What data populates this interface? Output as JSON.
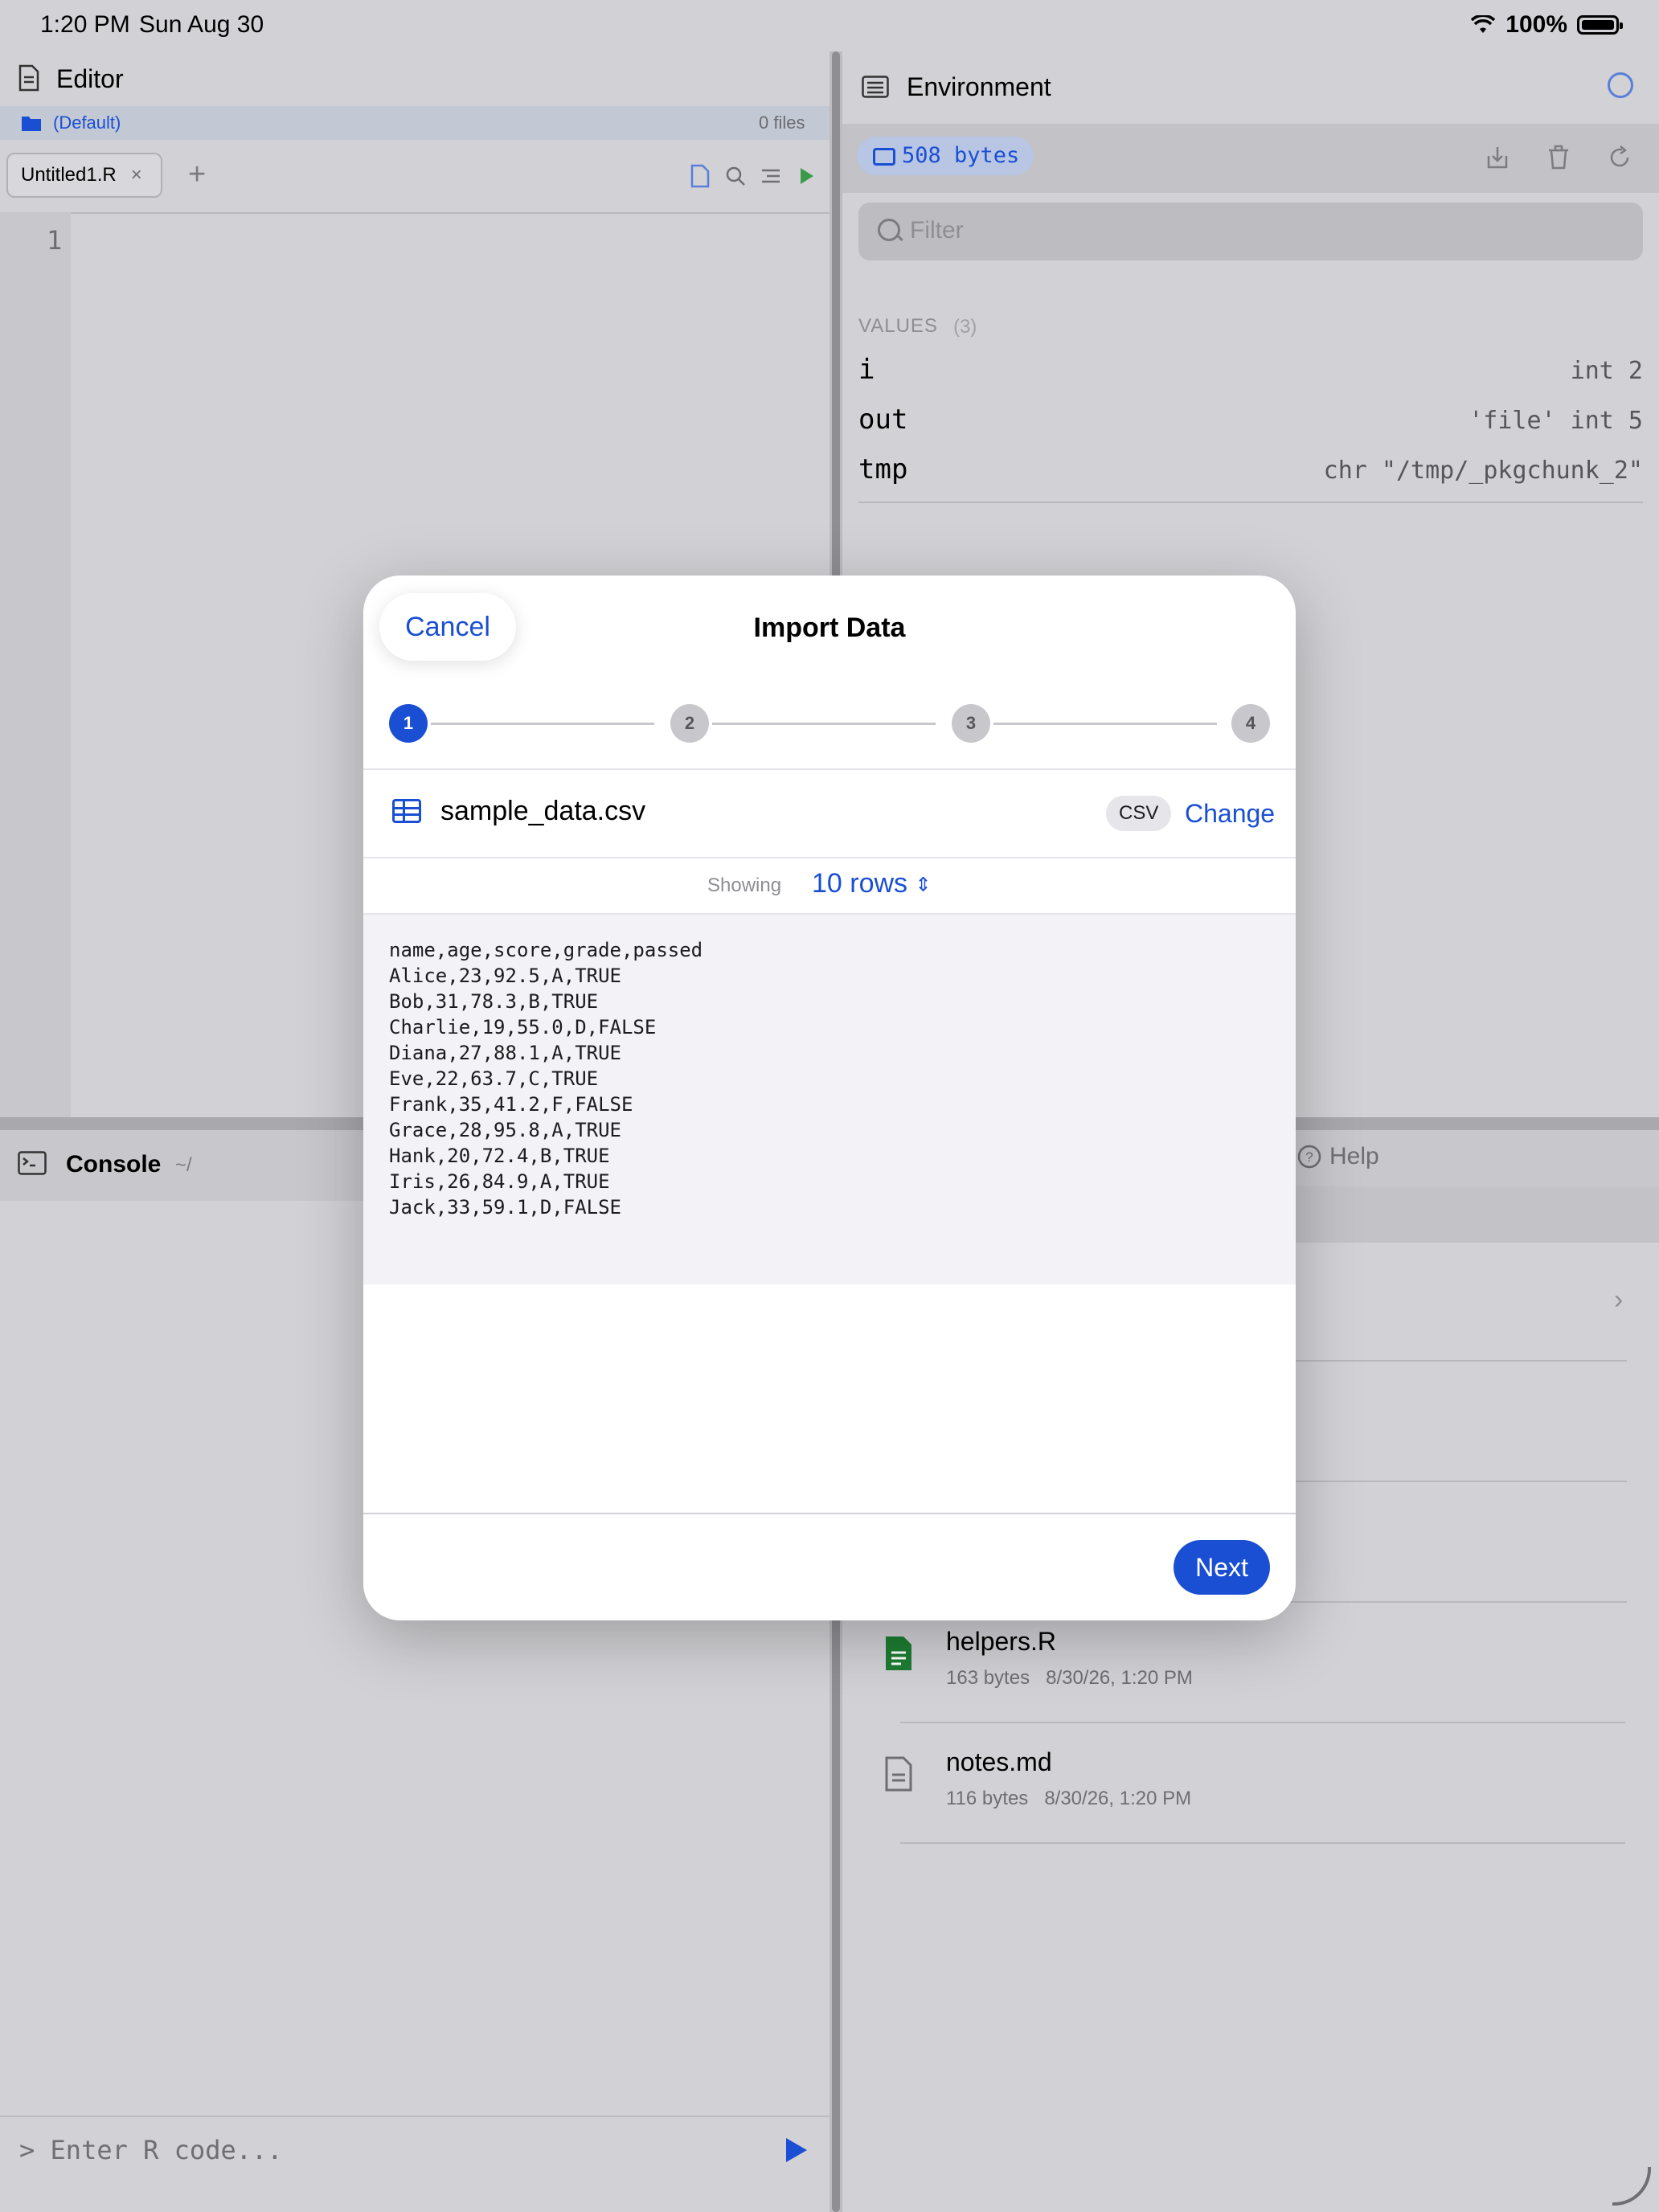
{
  "status_bar": {
    "time": "1:20 PM",
    "date": "Sun Aug 30",
    "battery": "100%"
  },
  "editor": {
    "title": "Editor",
    "project": "(Default)",
    "file_count": "0 files",
    "tab_label": "Untitled1.R",
    "tab_close": "×",
    "add_tab": "+",
    "line_number": "1"
  },
  "console": {
    "title": "Console",
    "path": "~/",
    "placeholder": "> Enter R code..."
  },
  "environment": {
    "title": "Environment",
    "memory": "508 bytes",
    "filter_placeholder": "Filter",
    "section_label": "VALUES",
    "section_count": "(3)",
    "variables": [
      {
        "name": "i",
        "value": "int 2"
      },
      {
        "name": "out",
        "value": "'file' int 5"
      },
      {
        "name": "tmp",
        "value": "chr \"/tmp/_pkgchunk_2\""
      }
    ]
  },
  "files_panel": {
    "help_tab": "Help",
    "files": [
      {
        "name": "helpers.R",
        "size": "163 bytes",
        "date": "8/30/26, 1:20 PM",
        "icon": "r-file-icon"
      },
      {
        "name": "notes.md",
        "size": "116 bytes",
        "date": "8/30/26, 1:20 PM",
        "icon": "document-icon"
      }
    ]
  },
  "modal": {
    "cancel": "Cancel",
    "title": "Import Data",
    "steps": [
      "1",
      "2",
      "3",
      "4"
    ],
    "active_step": 1,
    "filename": "sample_data.csv",
    "format_badge": "CSV",
    "change": "Change",
    "showing_label": "Showing",
    "rows_selector": "10 rows",
    "preview_lines": [
      "name,age,score,grade,passed",
      "Alice,23,92.5,A,TRUE",
      "Bob,31,78.3,B,TRUE",
      "Charlie,19,55.0,D,FALSE",
      "Diana,27,88.1,A,TRUE",
      "Eve,22,63.7,C,TRUE",
      "Frank,35,41.2,F,FALSE",
      "Grace,28,95.8,A,TRUE",
      "Hank,20,72.4,B,TRUE",
      "Iris,26,84.9,A,TRUE",
      "Jack,33,59.1,D,FALSE"
    ],
    "next": "Next"
  },
  "colors": {
    "accent": "#1a4fd4",
    "r_file": "#1e7d32"
  }
}
